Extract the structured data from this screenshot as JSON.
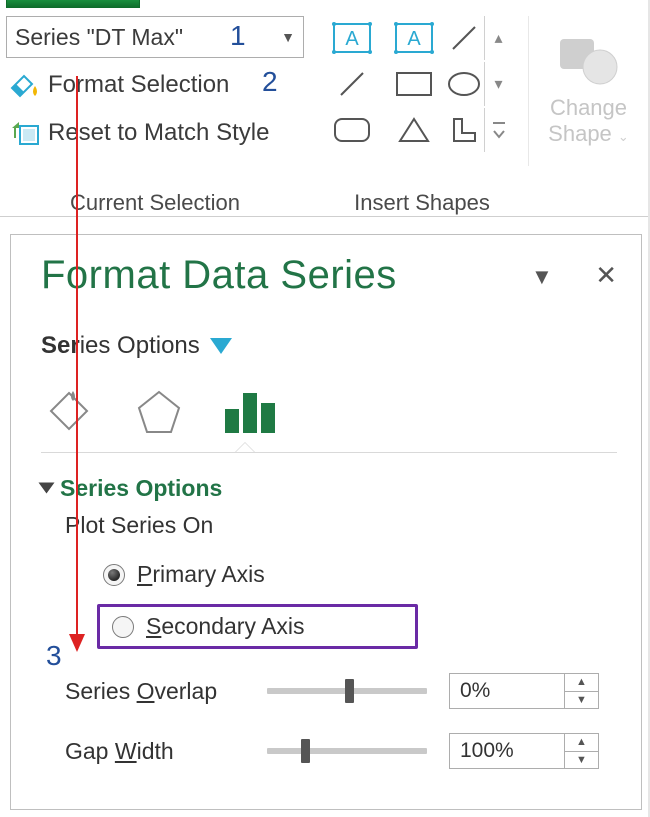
{
  "ribbon": {
    "series_selector": "Series \"DT Max\"",
    "format_selection": "Format Selection",
    "reset_to_match": "Reset to Match Style",
    "group_current_selection": "Current Selection",
    "group_insert_shapes": "Insert Shapes",
    "change_shape_l1": "Change",
    "change_shape_l2": "Shape"
  },
  "pane": {
    "title": "Format Data Series",
    "series_options_label": "Series Options",
    "section_title": "Series Options",
    "plot_on_label": "Plot Series On",
    "primary_prefix": "P",
    "primary_rest": "rimary Axis",
    "secondary_prefix": "S",
    "secondary_rest": "econdary Axis",
    "overlap_label_prefix": "Series ",
    "overlap_ul": "O",
    "overlap_label_rest": "verlap",
    "overlap_value": "0%",
    "gap_label_prefix": "Gap ",
    "gap_ul": "W",
    "gap_label_rest": "idth",
    "gap_value": "100%"
  },
  "annotations": {
    "n1": "1",
    "n2": "2",
    "n3": "3"
  },
  "icons": {
    "paint": "paint-bucket-icon",
    "reset": "reset-icon",
    "abox": "textbox-a-icon",
    "line": "line-shape-icon",
    "down": "chevron-down-icon",
    "rect": "rectangle-icon",
    "oval": "oval-icon",
    "rrect": "rounded-rect-icon",
    "tri": "triangle-icon",
    "lshape": "l-shape-icon",
    "fill": "fill-effects-icon",
    "pent": "effects-icon",
    "bars": "series-options-icon"
  }
}
